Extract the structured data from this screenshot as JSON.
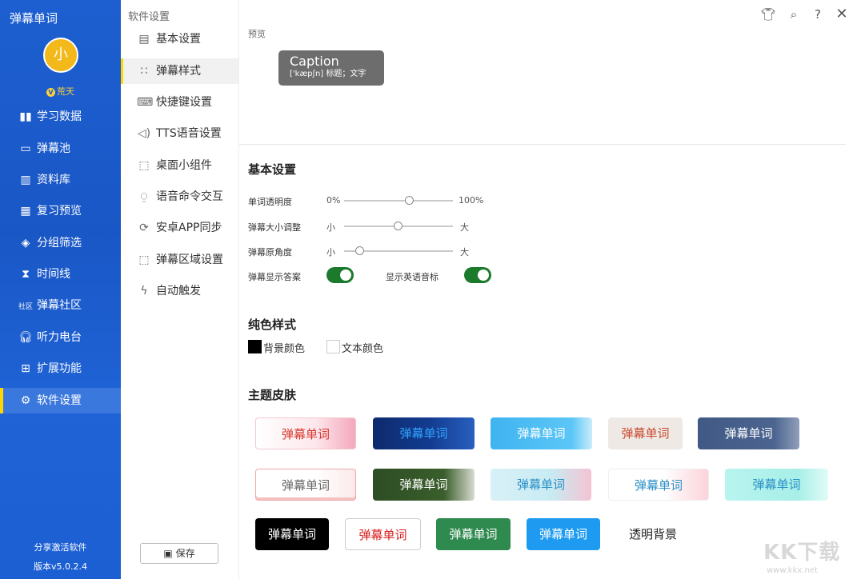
{
  "app": {
    "title": "弹幕单词"
  },
  "user": {
    "avatar_initial": "小",
    "vip_badge": "V",
    "level": "荒天"
  },
  "sidebar": {
    "items": [
      {
        "label": "学习数据"
      },
      {
        "label": "弹幕池"
      },
      {
        "label": "资料库"
      },
      {
        "label": "复习预览"
      },
      {
        "label": "分组筛选"
      },
      {
        "label": "时间线"
      },
      {
        "label": "弹幕社区",
        "icon_text": "社区"
      },
      {
        "label": "听力电台"
      },
      {
        "label": "扩展功能"
      },
      {
        "label": "软件设置"
      }
    ],
    "share": "分享激活软件",
    "version": "版本v5.0.2.4"
  },
  "settings_menu": {
    "title": "软件设置",
    "items": [
      {
        "label": "基本设置"
      },
      {
        "label": "弹幕样式"
      },
      {
        "label": "快捷键设置"
      },
      {
        "label": "TTS语音设置"
      },
      {
        "label": "桌面小组件"
      },
      {
        "label": "语音命令交互"
      },
      {
        "label": "安卓APP同步"
      },
      {
        "label": "弹幕区域设置"
      },
      {
        "label": "自动触发"
      }
    ],
    "save": "保存"
  },
  "preview": {
    "label": "预览",
    "word": "Caption",
    "description": "['kæpʃn] 标题；文字"
  },
  "basic": {
    "title": "基本设置",
    "opacity": {
      "label": "单词透明度",
      "min": "0%",
      "max": "100%",
      "value": 0.6
    },
    "size": {
      "label": "弹幕大小调整",
      "min": "小",
      "max": "大",
      "value": 0.5
    },
    "radius": {
      "label": "弹幕原角度",
      "min": "小",
      "max": "大",
      "value": 0.15
    },
    "show_answer": {
      "label": "弹幕显示答案",
      "on": true
    },
    "show_phonetic": {
      "label": "显示英语音标",
      "on": true
    }
  },
  "solid": {
    "title": "纯色样式",
    "bg": {
      "label": "背景颜色",
      "color": "#000000"
    },
    "text": {
      "label": "文本颜色",
      "color": "#ffffff"
    }
  },
  "skins": {
    "title": "主题皮肤",
    "row1": [
      "弹幕单词",
      "弹幕单词",
      "弹幕单词",
      "弹幕单词",
      "弹幕单词"
    ],
    "row2": [
      "弹幕单词",
      "弹幕单词",
      "弹幕单词",
      "弹幕单词",
      "弹幕单词"
    ],
    "row3": [
      "弹幕单词",
      "弹幕单词",
      "弹幕单词",
      "弹幕单词",
      "透明背景"
    ]
  },
  "watermark": {
    "text": "KK下载",
    "url": "www.kkx.net"
  },
  "colors": {
    "sidebar": "#1d5fd0",
    "accent": "#ffd600",
    "toggle": "#1b7a2b"
  }
}
